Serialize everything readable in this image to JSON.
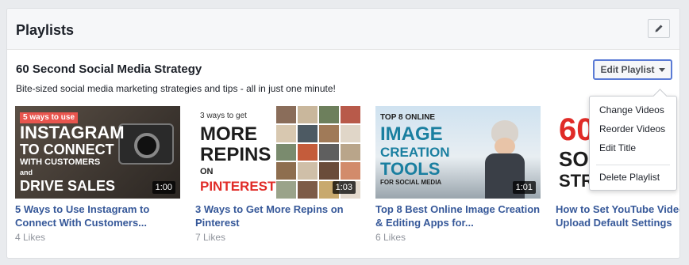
{
  "section": {
    "title": "Playlists"
  },
  "playlist": {
    "title": "60 Second Social Media Strategy",
    "description": "Bite-sized social media marketing strategies and tips - all in just one minute!",
    "edit_label": "Edit Playlist"
  },
  "menu": {
    "items": [
      "Change Videos",
      "Reorder Videos",
      "Edit Title"
    ],
    "delete_label": "Delete Playlist"
  },
  "videos": [
    {
      "title": "5 Ways to Use Instagram to Connect With Customers...",
      "likes": "4 Likes",
      "duration": "1:00",
      "thumb_lines": [
        "5 ways to use",
        "INSTAGRAM",
        "TO CONNECT",
        "WITH CUSTOMERS",
        "and",
        "DRIVE SALES"
      ]
    },
    {
      "title": "3 Ways to Get More Repins on Pinterest",
      "likes": "7 Likes",
      "duration": "1:03",
      "thumb_lines": [
        "3 ways to get",
        "MORE",
        "REPINS",
        "ON",
        "PINTEREST"
      ]
    },
    {
      "title": "Top 8 Best Online Image Creation & Editing Apps for...",
      "likes": "6 Likes",
      "duration": "1:01",
      "thumb_lines": [
        "TOP 8 ONLINE",
        "IMAGE",
        "CREATION",
        "TOOLS",
        "FOR SOCIAL MEDIA"
      ]
    },
    {
      "title": "How to Set YouTube Video Upload Default Settings",
      "likes": "",
      "duration": "",
      "thumb_lines": [
        "60",
        "SOC",
        "STRATEGY"
      ]
    }
  ],
  "colors": {
    "link": "#365899",
    "accent_red": "#e02b27",
    "focus_border": "#5b7bd5"
  }
}
